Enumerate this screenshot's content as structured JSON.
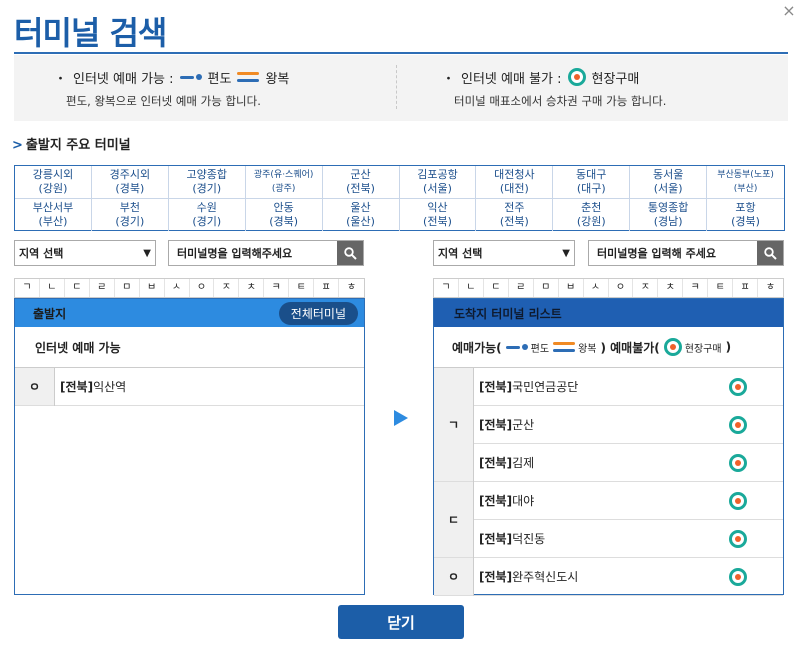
{
  "header": {
    "title": "터미널 검색",
    "close_symbol": "×"
  },
  "info": {
    "left": {
      "bullet": "・",
      "label": "인터넷 예매 가능 :",
      "oneway": "편도",
      "roundtrip": "왕복",
      "desc": "편도, 왕복으로 인터넷 예매 가능 합니다."
    },
    "right": {
      "bullet": "・",
      "label": "인터넷 예매 불가 :",
      "onsite": "현장구매",
      "desc": "터미널 매표소에서 승차권 구매 가능 합니다."
    }
  },
  "major": {
    "title": "출발지 주요 터미널",
    "chevron": ">",
    "terminals": [
      {
        "name": "강릉시외",
        "region": "(강원)"
      },
      {
        "name": "경주시외",
        "region": "(경북)"
      },
      {
        "name": "고양종합",
        "region": "(경기)"
      },
      {
        "name": "광주(유·스퀘어)",
        "region": "(광주)"
      },
      {
        "name": "군산",
        "region": "(전북)"
      },
      {
        "name": "김포공항",
        "region": "(서울)"
      },
      {
        "name": "대전청사",
        "region": "(대전)"
      },
      {
        "name": "동대구",
        "region": "(대구)"
      },
      {
        "name": "동서울",
        "region": "(서울)"
      },
      {
        "name": "부산동부(노포)",
        "region": "(부산)"
      },
      {
        "name": "부산서부",
        "region": "(부산)"
      },
      {
        "name": "부천",
        "region": "(경기)"
      },
      {
        "name": "수원",
        "region": "(경기)"
      },
      {
        "name": "안동",
        "region": "(경북)"
      },
      {
        "name": "울산",
        "region": "(울산)"
      },
      {
        "name": "익산",
        "region": "(전북)"
      },
      {
        "name": "전주",
        "region": "(전북)"
      },
      {
        "name": "춘천",
        "region": "(강원)"
      },
      {
        "name": "통영종합",
        "region": "(경남)"
      },
      {
        "name": "포항",
        "region": "(경북)"
      }
    ]
  },
  "left": {
    "region_select": "지역 선택",
    "search_placeholder": "터미널명을 입력해주세요",
    "consonants": [
      "ㄱ",
      "ㄴ",
      "ㄷ",
      "ㄹ",
      "ㅁ",
      "ㅂ",
      "ㅅ",
      "ㅇ",
      "ㅈ",
      "ㅊ",
      "ㅋ",
      "ㅌ",
      "ㅍ",
      "ㅎ"
    ],
    "panel_title": "출발지",
    "all_button": "전체터미널",
    "sub_title": "인터넷 예매 가능",
    "groups": [
      {
        "initial": "ㅇ",
        "items": [
          {
            "region": "[전북]",
            "name": "익산역"
          }
        ]
      }
    ]
  },
  "right": {
    "region_select": "지역 선택",
    "search_placeholder": "터미널명을 입력해 주세요",
    "consonants": [
      "ㄱ",
      "ㄴ",
      "ㄷ",
      "ㄹ",
      "ㅁ",
      "ㅂ",
      "ㅅ",
      "ㅇ",
      "ㅈ",
      "ㅊ",
      "ㅋ",
      "ㅌ",
      "ㅍ",
      "ㅎ"
    ],
    "panel_title": "도착지 터미널 리스트",
    "legend": {
      "possible": "예매가능(",
      "oneway": "편도",
      "roundtrip": "왕복",
      "impossible": ") 예매불가(",
      "onsite": "현장구매",
      "close": ")"
    },
    "groups": [
      {
        "initial": "ㄱ",
        "items": [
          {
            "region": "[전북]",
            "name": "국민연금공단"
          },
          {
            "region": "[전북]",
            "name": "군산"
          },
          {
            "region": "[전북]",
            "name": "김제"
          }
        ]
      },
      {
        "initial": "ㄷ",
        "items": [
          {
            "region": "[전북]",
            "name": "대야"
          },
          {
            "region": "[전북]",
            "name": "덕진동"
          }
        ]
      },
      {
        "initial": "ㅇ",
        "items": [
          {
            "region": "[전북]",
            "name": "완주혁신도시"
          }
        ]
      }
    ]
  },
  "footer": {
    "close_button": "닫기"
  }
}
